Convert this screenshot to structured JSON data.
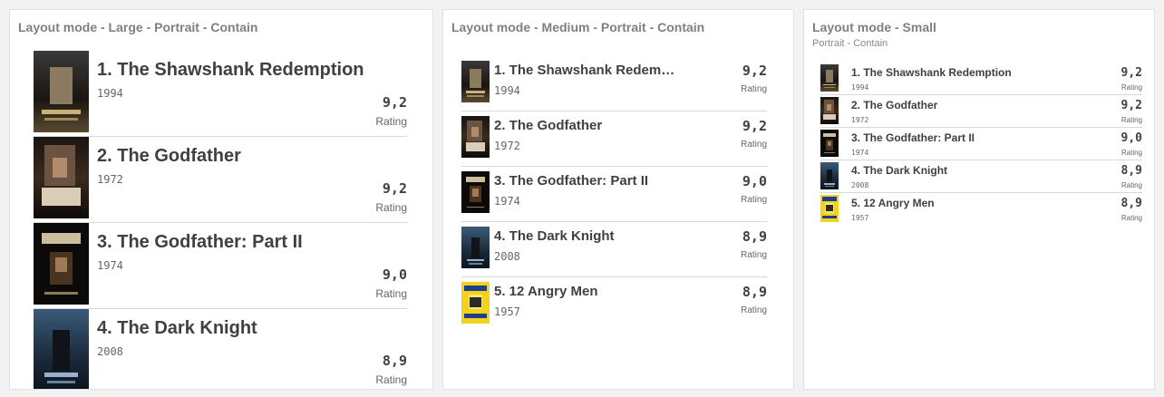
{
  "panels": [
    {
      "title": "Layout mode - Large - Portrait - Contain",
      "subtitle": "",
      "items": [
        {
          "title": "1. The Shawshank Redemption",
          "year": "1994",
          "value": "9,2",
          "label": "Rating",
          "poster": "shawshank"
        },
        {
          "title": "2. The Godfather",
          "year": "1972",
          "value": "9,2",
          "label": "Rating",
          "poster": "godfather"
        },
        {
          "title": "3. The Godfather: Part II",
          "year": "1974",
          "value": "9,0",
          "label": "Rating",
          "poster": "godfather2"
        },
        {
          "title": "4. The Dark Knight",
          "year": "2008",
          "value": "8,9",
          "label": "Rating",
          "poster": "darkknight"
        }
      ]
    },
    {
      "title": "Layout mode - Medium - Portrait - Contain",
      "subtitle": "",
      "items": [
        {
          "title": "1. The Shawshank Redem…",
          "year": "1994",
          "value": "9,2",
          "label": "Rating",
          "poster": "shawshank"
        },
        {
          "title": "2. The Godfather",
          "year": "1972",
          "value": "9,2",
          "label": "Rating",
          "poster": "godfather"
        },
        {
          "title": "3. The Godfather: Part II",
          "year": "1974",
          "value": "9,0",
          "label": "Rating",
          "poster": "godfather2"
        },
        {
          "title": "4. The Dark Knight",
          "year": "2008",
          "value": "8,9",
          "label": "Rating",
          "poster": "darkknight"
        },
        {
          "title": "5. 12 Angry Men",
          "year": "1957",
          "value": "8,9",
          "label": "Rating",
          "poster": "angrymen"
        }
      ]
    },
    {
      "title": "Layout mode - Small",
      "subtitle": "Portrait - Contain",
      "items": [
        {
          "title": "1. The Shawshank Redemption",
          "year": "1994",
          "value": "9,2",
          "label": "Rating",
          "poster": "shawshank"
        },
        {
          "title": "2. The Godfather",
          "year": "1972",
          "value": "9,2",
          "label": "Rating",
          "poster": "godfather"
        },
        {
          "title": "3. The Godfather: Part II",
          "year": "1974",
          "value": "9,0",
          "label": "Rating",
          "poster": "godfather2"
        },
        {
          "title": "4. The Dark Knight",
          "year": "2008",
          "value": "8,9",
          "label": "Rating",
          "poster": "darkknight"
        },
        {
          "title": "5. 12 Angry Men",
          "year": "1957",
          "value": "8,9",
          "label": "Rating",
          "poster": "angrymen"
        }
      ]
    }
  ],
  "colors": {
    "background": "#f2f2f2",
    "panel": "#ffffff",
    "title": "#7f7f7f",
    "text": "#404040",
    "divider": "#d9d9d9"
  }
}
